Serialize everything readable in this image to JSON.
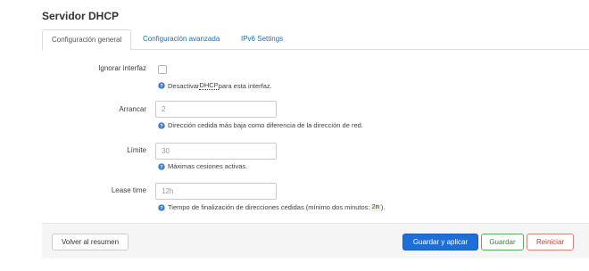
{
  "section": {
    "title": "Servidor DHCP"
  },
  "tabs": [
    {
      "label": "Configuración general",
      "active": true
    },
    {
      "label": "Configuración avanzada",
      "active": false
    },
    {
      "label": "IPv6 Settings",
      "active": false
    }
  ],
  "fields": {
    "ignore": {
      "label": "Ignorar interfaz",
      "checked": false,
      "help_prefix": "Desactivar ",
      "help_abbr": "DHCP",
      "help_suffix": " para esta interfaz."
    },
    "start": {
      "label": "Arrancar",
      "value": "2",
      "help": "Dirección cedida más baja como diferencia de la dirección de red."
    },
    "limit": {
      "label": "Límite",
      "value": "30",
      "help": "Máximas cesiones activas."
    },
    "leasetime": {
      "label": "Lease time",
      "value": "12h",
      "help_prefix": "Tiempo de finalización de direcciones cedidas (mínimo dos minutos: ",
      "help_code": "2m",
      "help_suffix": ")."
    }
  },
  "footer": {
    "back_label": "Volver al resumen",
    "apply_label": "Guardar y aplicar",
    "save_label": "Guardar",
    "reset_label": "Reiniciar"
  },
  "colors": {
    "link": "#1a6fc2",
    "primary": "#1e6ed8",
    "save": "#2e8b3a",
    "reset": "#b8413c",
    "help_icon": "#3a7bc8"
  },
  "icons": {
    "help": "help-icon"
  }
}
